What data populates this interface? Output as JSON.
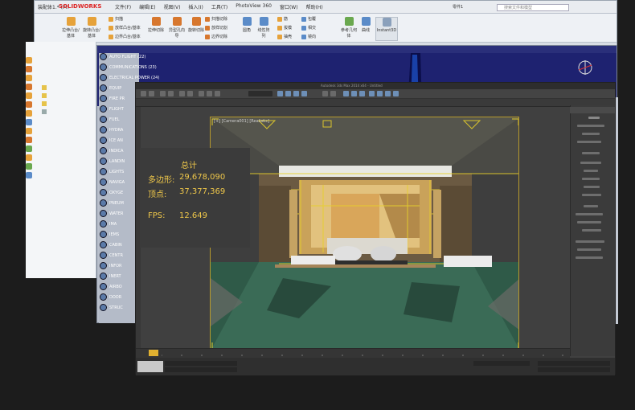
{
  "solidworks": {
    "window_title": "装配体1.* (Pri",
    "logo": "SOLIDWORKS",
    "menu": [
      "文件(F)",
      "编辑(E)",
      "视图(V)",
      "插入(I)",
      "工具(T)",
      "PhotoView 360",
      "窗口(W)",
      "帮助(H)"
    ],
    "search_placeholder": "搜索文件和模型",
    "zoom_label": "零件1",
    "ribbon": {
      "big_buttons": [
        "拉伸凸台/基体",
        "旋转凸台/基体",
        "拉伸切除",
        "异型孔向导",
        "旋转切除",
        "参考几何体",
        "曲线",
        "Instant3D"
      ],
      "small_buttons": [
        "扫描",
        "放样凸台/基体",
        "边界凸台/基体",
        "扫描切除",
        "放样切割",
        "边界切除",
        "圆角",
        "线性阵列",
        "筋",
        "拔模",
        "抽壳",
        "包覆",
        "相交",
        "镜向"
      ]
    }
  },
  "catia": {
    "tree_items": [
      "AUTO FLIGHT (22)",
      "COMMUNICATIONS (23)",
      "ELECTRICAL POWER (24)",
      "EQUIP",
      "FIRE PR",
      "FLIGHT",
      "FUEL",
      "HYDRA",
      "ICE AN",
      "INDICA",
      "LANDIN",
      "LIGHTS",
      "NAVIGA",
      "OXYGE",
      "PNEUM",
      "WATER",
      "IMA",
      "IEMS",
      "CABIN",
      "CENTR",
      "INFOR",
      "INERT",
      "AIRBO",
      "DOOR",
      "STRUC"
    ]
  },
  "max": {
    "title": "Autodesk 3ds Max 2014 x64 - Untitled",
    "viewport_label": "[+] [Camera001] [Realistic]",
    "stats": {
      "title": "总计",
      "poly_label": "多边形:",
      "poly_value": "29,678,090",
      "vert_label": "顶点:",
      "vert_value": "37,377,369",
      "fps_label": "FPS:",
      "fps_value": "12.649"
    }
  },
  "colors": {
    "stats_text": "#f0c84a",
    "stats_bg": "#3b3b3b",
    "catia_blue": "#1e2270",
    "viewport_border": "#b79a2c"
  }
}
